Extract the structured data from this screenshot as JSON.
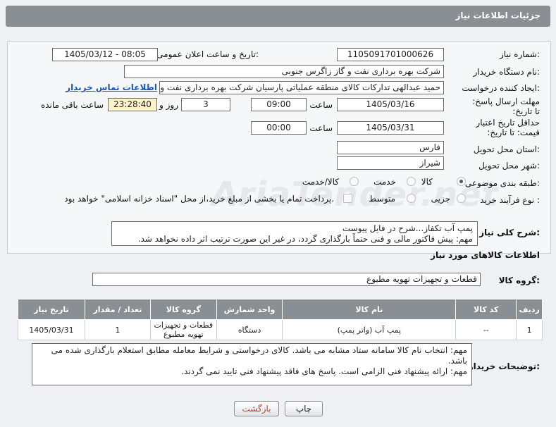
{
  "header": {
    "title": "جزئیات اطلاعات نیاز"
  },
  "form": {
    "need_number_label": "شماره نیاز:",
    "need_number": "1105091701000626",
    "announce_label": "تاریخ و ساعت اعلان عمومی:",
    "announce_value": "1405/03/12 - 08:05",
    "buyer_label": "نام دستگاه خریدار:",
    "buyer_value": "شرکت بهره برداری نفت و گاز زاگرس جنوبی",
    "requester_label": "ایجاد کننده درخواست:",
    "requester_value": "حمید عبدالهی تدارکات کالای منطقه عملیاتی پارسیان شرکت بهره برداری نفت و",
    "contact_link": "اطلاعات تماس خریدار",
    "deadline_label": "مهلت ارسال پاسخ: تا تاریخ:",
    "deadline_date": "1405/03/16",
    "time_label": "ساعت",
    "deadline_time": "09:00",
    "days_value": "3",
    "days_label": "روز و",
    "remaining_value": "23:28:40",
    "remaining_label": "ساعت باقی مانده",
    "validity_label": "حداقل تاریخ اعتبار قیمت: تا تاریخ:",
    "validity_date": "1405/03/31",
    "validity_time": "00:00",
    "province_label": "استان محل تحویل:",
    "province_value": "فارس",
    "city_label": "شهر محل تحویل:",
    "city_value": "شیراز",
    "category_label": "طبقه بندی موضوعی:",
    "category_options": [
      "کالا",
      "خدمت",
      "کالا/خدمت"
    ],
    "category_selected": 0,
    "purchase_label": "نوع فرآیند خرید :",
    "purchase_options": [
      "جزیی",
      "متوسط"
    ],
    "payment_note": "پرداخت تمام یا بخشی از مبلغ خرید،از محل \"اسناد خزانه اسلامی\" خواهد بود.",
    "summary_label": "شرح کلی نیاز:",
    "summary_line1": "پمپ آب تکفاز...شرح در فایل پیوست",
    "summary_line2": "مهم: پیش فاکتور مالی و فنی حتماً بارگذاری گردد، در غیر این صورت ترتیب اثر داده نخواهد شد."
  },
  "goods": {
    "section_title": "اطلاعات کالاهای مورد نیاز",
    "group_label": "گروه کالا:",
    "group_value": "قطعات و تجهیزات تهویه مطبوع",
    "columns": [
      "ردیف",
      "کد کالا",
      "نام کالا",
      "واحد شمارش",
      "گروه کالا",
      "تعداد / مقدار",
      "تاریخ نیاز"
    ],
    "rows": [
      {
        "idx": "1",
        "code": "--",
        "name": "پمپ آب (واتر پمپ)",
        "unit": "دستگاه",
        "group": "قطعات و تجهیزات تهویه مطبوع",
        "qty": "1",
        "date": "1405/03/31"
      }
    ]
  },
  "notes": {
    "label": "توضیحات خریدار:",
    "line1": "مهم: انتخاب نام کالا سامانه ستاد مشابه می باشد. کالای درخواستی و شرایط معامله مطابق استعلام بارگذاری شده می باشد.",
    "line2": "مهم: ارائه پیشنهاد فنی الزامی است. پاسخ های فاقد پیشنهاد فنی تایید نمی گردند."
  },
  "buttons": {
    "print": "چاپ",
    "back": "بازگشت"
  },
  "watermark": "AriaTender.net"
}
